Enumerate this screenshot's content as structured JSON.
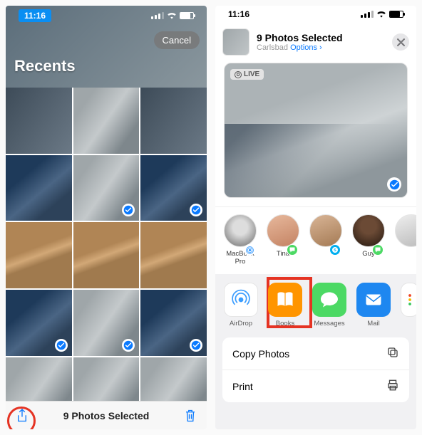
{
  "status": {
    "time": "11:16"
  },
  "left": {
    "cancel_label": "Cancel",
    "album_title": "Recents",
    "bottom_caption": "9 Photos Selected",
    "photos": [
      {
        "selected": false,
        "variant": "dark"
      },
      {
        "selected": false,
        "variant": "plain"
      },
      {
        "selected": false,
        "variant": "dark"
      },
      {
        "selected": false,
        "variant": "dkblu"
      },
      {
        "selected": true,
        "variant": "plain"
      },
      {
        "selected": true,
        "variant": "dkblu"
      },
      {
        "selected": false,
        "variant": "wood"
      },
      {
        "selected": false,
        "variant": "wood"
      },
      {
        "selected": false,
        "variant": "wood"
      },
      {
        "selected": true,
        "variant": "dkblu"
      },
      {
        "selected": true,
        "variant": "plain"
      },
      {
        "selected": true,
        "variant": "dkblu"
      },
      {
        "selected": false,
        "variant": "plain"
      },
      {
        "selected": false,
        "variant": "plain"
      },
      {
        "selected": false,
        "variant": "plain"
      }
    ]
  },
  "right": {
    "header_title": "9 Photos Selected",
    "header_location": "Carlsbad",
    "header_options": "Options ›",
    "live_label": "LIVE",
    "contacts": [
      {
        "name": "MacBook Pro",
        "avatar": "mbp",
        "badge": "airdrop"
      },
      {
        "name": "Tina",
        "avatar": "tina",
        "badge": "sms"
      },
      {
        "name": "",
        "avatar": "blank1",
        "badge": "skype"
      },
      {
        "name": "Guy",
        "avatar": "guy",
        "badge": "sms"
      },
      {
        "name": "",
        "avatar": "edge",
        "badge": null
      }
    ],
    "apps": [
      {
        "name": "AirDrop",
        "icon": "airdrop"
      },
      {
        "name": "Books",
        "icon": "books"
      },
      {
        "name": "Messages",
        "icon": "messages"
      },
      {
        "name": "Mail",
        "icon": "mail"
      },
      {
        "name": "",
        "icon": "more"
      }
    ],
    "actions": [
      {
        "label": "Copy Photos",
        "icon": "copy"
      },
      {
        "label": "Print",
        "icon": "print"
      }
    ]
  }
}
